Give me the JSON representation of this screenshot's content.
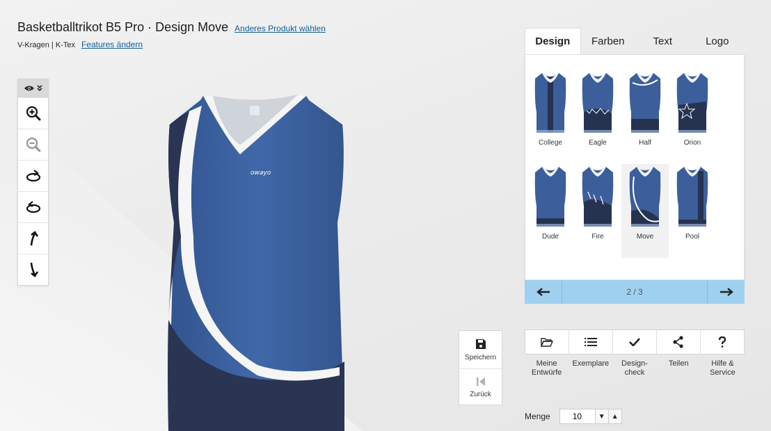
{
  "header": {
    "title": "Basketballtrikot B5 Pro · Design Move",
    "change_product_link": "Anderes Produkt wählen",
    "specs": "V-Kragen | K-Tex",
    "change_features_link": "Features ändern"
  },
  "jersey": {
    "brand_text": "owayo"
  },
  "tabs": [
    {
      "label": "Design",
      "active": true
    },
    {
      "label": "Farben",
      "active": false
    },
    {
      "label": "Text",
      "active": false
    },
    {
      "label": "Logo",
      "active": false
    }
  ],
  "designs": [
    {
      "label": "College"
    },
    {
      "label": "Eagle"
    },
    {
      "label": "Half"
    },
    {
      "label": "Orion"
    },
    {
      "label": "Dude"
    },
    {
      "label": "Fire"
    },
    {
      "label": "Move",
      "selected": true
    },
    {
      "label": "Pool"
    }
  ],
  "pager": {
    "text": "2 / 3"
  },
  "save_box": {
    "save_label": "Speichern",
    "back_label": "Zurück"
  },
  "actions": [
    {
      "label": "Meine\nEntwürfe",
      "icon": "folder-icon"
    },
    {
      "label": "Exemplare",
      "icon": "list-icon"
    },
    {
      "label": "Design-\ncheck",
      "icon": "check-icon"
    },
    {
      "label": "Teilen",
      "icon": "share-icon"
    },
    {
      "label": "Hilfe &\nService",
      "icon": "question-icon"
    }
  ],
  "quantity": {
    "label": "Menge",
    "value": "10"
  },
  "colors": {
    "jersey_blue": "#3c5f9c",
    "jersey_navy": "#2a3553",
    "pager_bg": "#9fd0f0",
    "link": "#0f5f99"
  }
}
